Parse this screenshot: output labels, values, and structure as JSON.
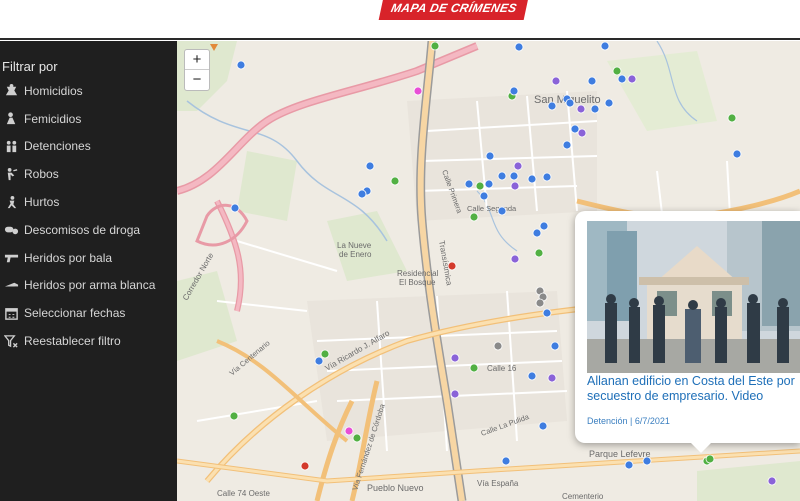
{
  "brand": {
    "title": "MAPA DE CRÍMENES"
  },
  "sidebar": {
    "title": "Filtrar por",
    "items": [
      {
        "label": "Homicidios",
        "icon": "homicide-icon"
      },
      {
        "label": "Femicidios",
        "icon": "femicide-icon"
      },
      {
        "label": "Detenciones",
        "icon": "arrest-icon"
      },
      {
        "label": "Robos",
        "icon": "robbery-icon"
      },
      {
        "label": "Hurtos",
        "icon": "theft-icon"
      },
      {
        "label": "Descomisos de droga",
        "icon": "pills-icon"
      },
      {
        "label": "Heridos por bala",
        "icon": "gun-icon"
      },
      {
        "label": "Heridos por arma blanca",
        "icon": "knife-icon"
      },
      {
        "label": "Seleccionar fechas",
        "icon": "calendar-icon"
      },
      {
        "label": "Reestablecer filtro",
        "icon": "filter-reset-icon"
      }
    ]
  },
  "map": {
    "zoom_in": "+",
    "zoom_out": "−",
    "labels": {
      "san_miguelito": "San Miguelito",
      "nueve_enero": "La Nueve",
      "nueve_enero2": "de Enero",
      "residencial": "Residencial",
      "bosque": "El Bosque",
      "calle16": "Calle 16",
      "parque_lefevre": "Parque Lefevre",
      "pueblo_nuevo": "Pueblo Nuevo",
      "calle74": "Calle 74 Oeste",
      "cementerio": "Cementerio",
      "via_espana": "Vía España",
      "ricardo_alfaro": "Vía Ricardo J. Alfaro",
      "corredor_norte": "Corredor Norte",
      "transistmica": "Transístmica",
      "calle_primera": "Calle Primera",
      "calle_segunda": "Calle Segunda",
      "via_fernandez": "Vía Fernández de Córdoba",
      "calle_la_pulida": "Calle La Pulida",
      "tumba_muerto": "Vía Centenario"
    },
    "colors": {
      "homicide": "#d33a2c",
      "robbery": "#3f7de0",
      "arrest": "#52b043",
      "femicide": "#e84fd6",
      "theft": "#8a63d8",
      "drugs": "#8a8a8a"
    }
  },
  "popup": {
    "headline": "Allanan edificio en Costa del Este por secuestro de empresario. Video",
    "category": "Detención",
    "date": "6/7/2021",
    "meta_sep": " | "
  }
}
